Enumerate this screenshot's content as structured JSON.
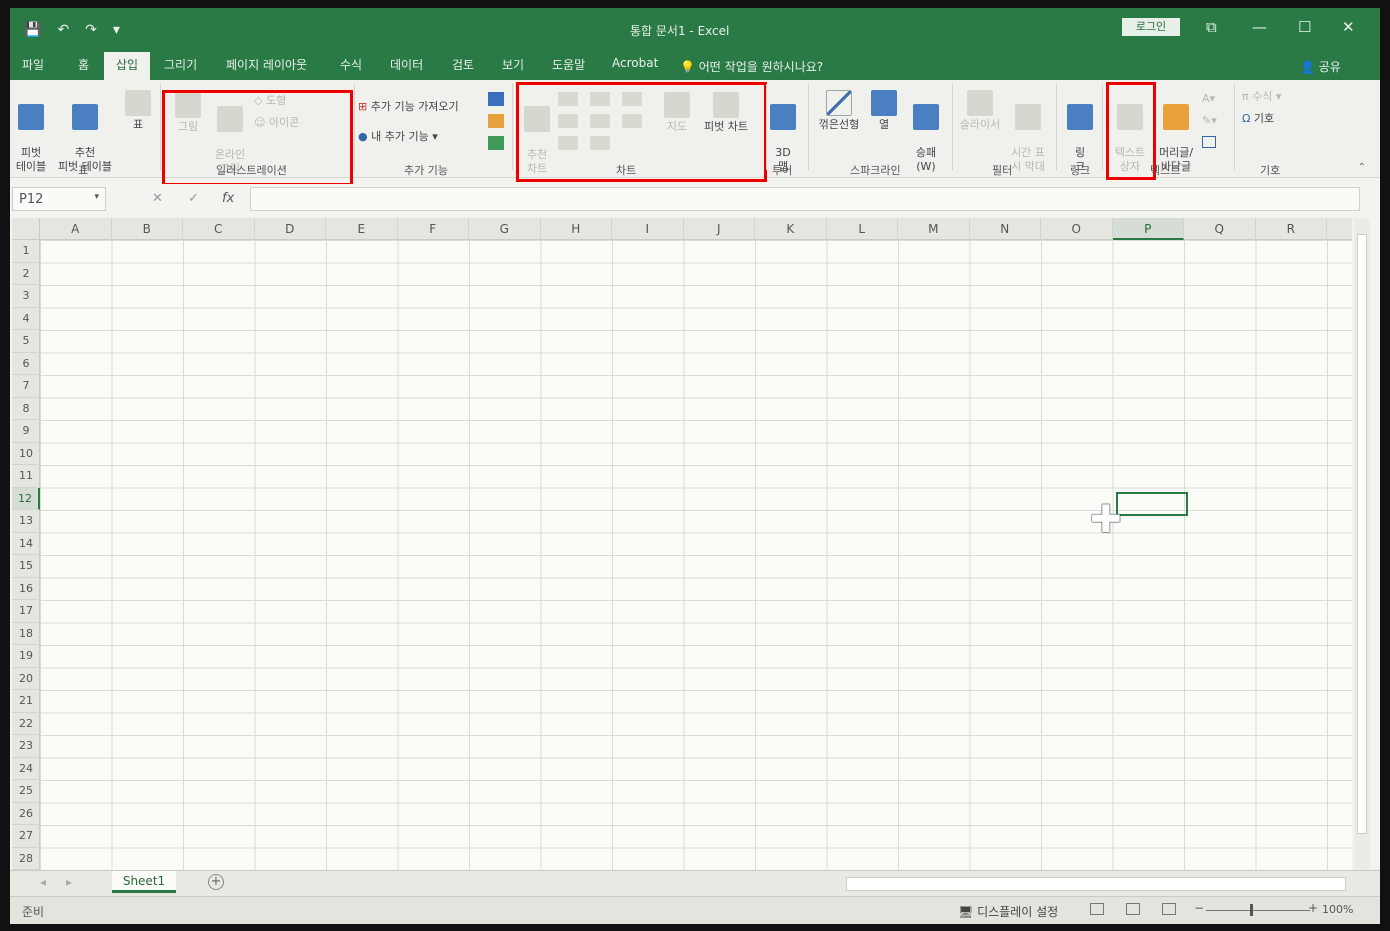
{
  "window": {
    "title": "통합 문서1  -  Excel",
    "login": "로그인",
    "qat": [
      "💾",
      "↶",
      "↷",
      "▾"
    ],
    "controls": [
      "⧉",
      "—",
      "☐",
      "✕"
    ]
  },
  "tabs": [
    "파일",
    "홈",
    "삽입",
    "그리기",
    "페이지 레이아웃",
    "수식",
    "데이터",
    "검토",
    "보기",
    "도움말",
    "Acrobat"
  ],
  "active_tab": "삽입",
  "tell_me": "어떤 작업을 원하시나요?",
  "share": "공유",
  "ribbon": {
    "tables": {
      "pivot": "피벗\n테이블",
      "recommended_pivot": "추천\n피벗 테이블",
      "table": "표",
      "group": "표"
    },
    "illustrations": {
      "picture": "그림",
      "online_picture": "온라인\n그림",
      "shapes": "도형",
      "icons": "아이콘",
      "group": "일러스트레이션"
    },
    "addins": {
      "get": "추가 기능 가져오기",
      "my": "내 추가 기능",
      "group": "추가 기능"
    },
    "charts": {
      "recommended": "추천\n차트",
      "maps": "지도",
      "pivot_chart": "피벗 차트",
      "group": "차트"
    },
    "tours": {
      "map3d": "3D\n맵",
      "group": "투어"
    },
    "sparklines": {
      "line": "꺾은선형",
      "column": "열",
      "winloss": "승패\n(W)",
      "group": "스파크라인"
    },
    "filters": {
      "slicer": "슬라이서",
      "timeline": "시간 표\n시 막대",
      "group": "필터"
    },
    "links": {
      "link": "링\n크",
      "group": "링크"
    },
    "text": {
      "textbox": "텍스트\n상자",
      "header_footer": "머리글/\n바닥글",
      "group": "텍스트"
    },
    "symbols": {
      "equation": "수식",
      "symbol": "기호",
      "group": "기호"
    }
  },
  "formula_bar": {
    "name_box": "P12",
    "cancel": "✕",
    "enter": "✓",
    "fx": "fx"
  },
  "columns": [
    "A",
    "B",
    "C",
    "D",
    "E",
    "F",
    "G",
    "H",
    "I",
    "J",
    "K",
    "L",
    "M",
    "N",
    "O",
    "P",
    "Q",
    "R"
  ],
  "rows": [
    "1",
    "2",
    "3",
    "4",
    "5",
    "6",
    "7",
    "8",
    "9",
    "10",
    "11",
    "12",
    "13",
    "14",
    "15",
    "16",
    "17",
    "18",
    "19",
    "20",
    "21",
    "22",
    "23",
    "24",
    "25",
    "26",
    "27",
    "28"
  ],
  "selected_column": "P",
  "selected_row": "12",
  "sheet_tab": "Sheet1",
  "status": {
    "ready": "준비",
    "display_settings": "디스플레이 설정",
    "zoom": "100%"
  },
  "colors": {
    "accent": "#2a7a45",
    "highlight": "#e00000"
  }
}
